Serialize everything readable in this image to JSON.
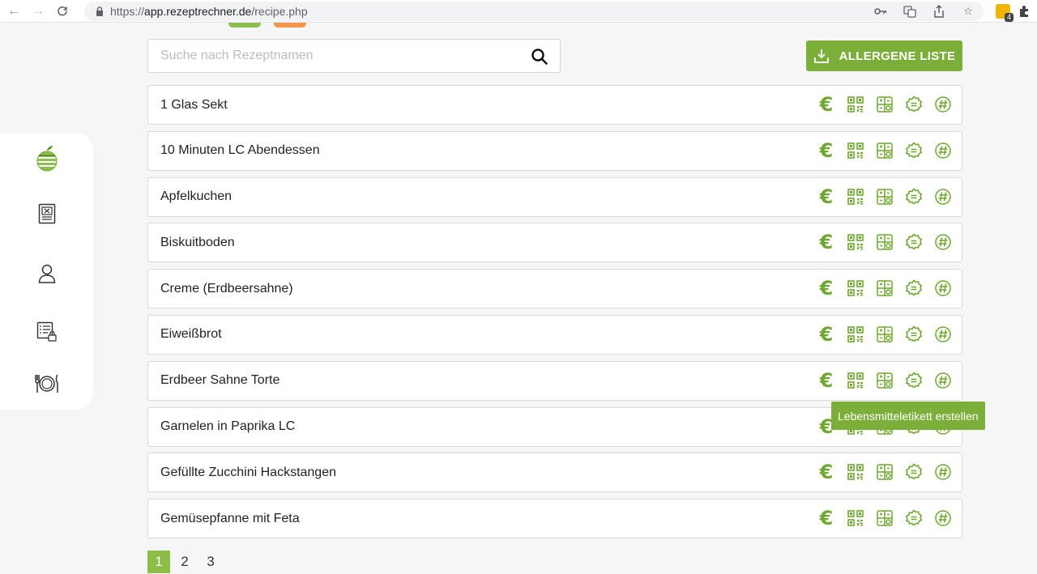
{
  "browser": {
    "url_protocol": "https://",
    "url_host": "app.rezeptrechner.de",
    "url_path": "/recipe.php",
    "extension_badge": "4"
  },
  "search": {
    "placeholder": "Suche nach Rezeptnamen"
  },
  "allergen_button": {
    "label": "ALLERGENE LISTE"
  },
  "recipes": [
    {
      "name": "1 Glas Sekt"
    },
    {
      "name": "10 Minuten LC Abendessen"
    },
    {
      "name": "Apfelkuchen"
    },
    {
      "name": "Biskuitboden"
    },
    {
      "name": "Creme (Erdbeersahne)"
    },
    {
      "name": "Eiweißbrot"
    },
    {
      "name": "Erdbeer Sahne Torte"
    },
    {
      "name": "Garnelen in Paprika LC"
    },
    {
      "name": "Gefüllte Zucchini Hackstangen"
    },
    {
      "name": "Gemüsepfanne mit Feta"
    }
  ],
  "row_actions": {
    "euro_symbol": "€",
    "icons": [
      "euro-icon",
      "qr-code-icon",
      "food-label-icon",
      "nutrition-badge-icon",
      "hashtag-icon"
    ]
  },
  "tooltip": {
    "text": "Lebensmitteletikett erstellen"
  },
  "pagination": {
    "pages": [
      "1",
      "2",
      "3"
    ],
    "active": "1"
  },
  "colors": {
    "accent": "#7cae3a",
    "icon_green": "#6ea82e",
    "page_active": "#8cbd46"
  }
}
